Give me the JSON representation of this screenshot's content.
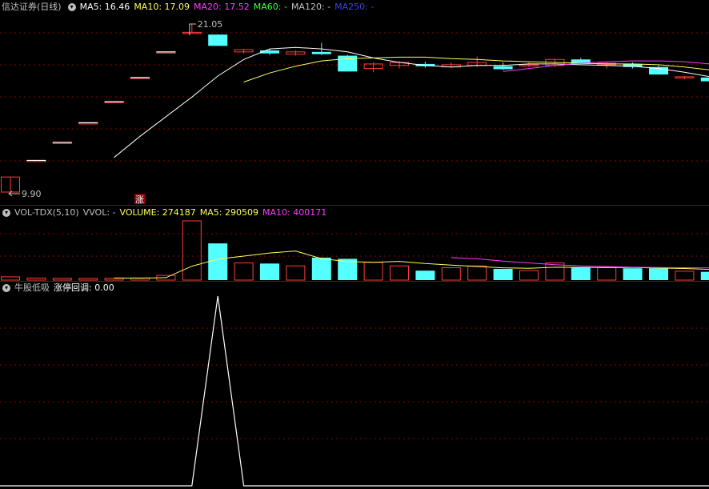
{
  "colors": {
    "up": "#ff3c3c",
    "down": "#54ffff",
    "ma5": "#ffffff",
    "ma10": "#ffff5a",
    "ma20": "#ff3cff",
    "ma60": "#3cff3c",
    "ma120": "#c0c0c0",
    "ma250": "#3c3cff",
    "grid": "#8b0000",
    "text": "#c0c0c0"
  },
  "panel_main": {
    "title": "信达证券(日线)",
    "ma_labels": [
      {
        "label": "MA5: 16.46",
        "color": "#ffffff"
      },
      {
        "label": "MA10: 17.09",
        "color": "#ffff5a"
      },
      {
        "label": "MA20: 17.52",
        "color": "#ff3cff"
      },
      {
        "label": "MA60: -",
        "color": "#3cff3c"
      },
      {
        "label": "MA120: -",
        "color": "#c0c0c0"
      },
      {
        "label": "MA250: -",
        "color": "#3c3cff"
      }
    ],
    "high_marker": "21.05",
    "low_marker": "9.90",
    "limit_badge": "涨"
  },
  "panel_vol": {
    "labels": [
      {
        "label": "VOL-TDX(5,10)",
        "color": "#c0c0c0"
      },
      {
        "label": "VVOL: -",
        "color": "#c0c0c0"
      },
      {
        "label": "VOLUME: 274187",
        "color": "#ffff5a"
      },
      {
        "label": "MA5: 290509",
        "color": "#ffff5a"
      },
      {
        "label": "MA10: 400171",
        "color": "#ff3cff"
      }
    ]
  },
  "panel_ind": {
    "labels": [
      {
        "label": "牛股低吸",
        "color": "#c0c0c0"
      },
      {
        "label": "涨停回调: 0.00",
        "color": "#ffffff"
      }
    ]
  },
  "chart_data": [
    {
      "type": "candlestick",
      "ylim": [
        9.9,
        21.05
      ],
      "bars": [
        {
          "o": 9.9,
          "h": 10.9,
          "l": 9.9,
          "c": 10.9
        },
        {
          "o": 12.0,
          "h": 12.0,
          "l": 12.0,
          "c": 12.0
        },
        {
          "o": 13.2,
          "h": 13.2,
          "l": 13.2,
          "c": 13.2
        },
        {
          "o": 14.5,
          "h": 14.5,
          "l": 14.5,
          "c": 14.5
        },
        {
          "o": 15.9,
          "h": 15.9,
          "l": 15.9,
          "c": 15.9
        },
        {
          "o": 17.5,
          "h": 17.5,
          "l": 17.5,
          "c": 17.5
        },
        {
          "o": 19.2,
          "h": 19.2,
          "l": 19.2,
          "c": 19.2
        },
        {
          "o": 20.5,
          "h": 21.05,
          "l": 20.5,
          "c": 20.5
        },
        {
          "o": 20.35,
          "h": 20.35,
          "l": 19.6,
          "c": 19.6
        },
        {
          "o": 19.2,
          "h": 19.4,
          "l": 19.1,
          "c": 19.35
        },
        {
          "o": 19.3,
          "h": 19.4,
          "l": 19.0,
          "c": 19.1
        },
        {
          "o": 19.05,
          "h": 19.3,
          "l": 18.95,
          "c": 19.2
        },
        {
          "o": 19.2,
          "h": 19.8,
          "l": 19.0,
          "c": 19.05
        },
        {
          "o": 18.95,
          "h": 19.0,
          "l": 17.9,
          "c": 17.9
        },
        {
          "o": 18.1,
          "h": 18.5,
          "l": 17.85,
          "c": 18.4
        },
        {
          "o": 18.3,
          "h": 18.6,
          "l": 18.1,
          "c": 18.5
        },
        {
          "o": 18.4,
          "h": 18.55,
          "l": 18.15,
          "c": 18.25
        },
        {
          "o": 18.2,
          "h": 18.5,
          "l": 18.15,
          "c": 18.35
        },
        {
          "o": 18.3,
          "h": 18.9,
          "l": 18.2,
          "c": 18.5
        },
        {
          "o": 18.25,
          "h": 18.5,
          "l": 18.0,
          "c": 18.05
        },
        {
          "o": 18.3,
          "h": 18.5,
          "l": 18.2,
          "c": 18.35
        },
        {
          "o": 18.3,
          "h": 18.75,
          "l": 18.2,
          "c": 18.7
        },
        {
          "o": 18.7,
          "h": 18.8,
          "l": 18.4,
          "c": 18.4
        },
        {
          "o": 18.35,
          "h": 18.5,
          "l": 18.1,
          "c": 18.45
        },
        {
          "o": 18.4,
          "h": 18.5,
          "l": 18.1,
          "c": 18.2
        },
        {
          "o": 18.2,
          "h": 18.3,
          "l": 17.7,
          "c": 17.7
        },
        {
          "o": 17.5,
          "h": 17.6,
          "l": 17.4,
          "c": 17.55
        },
        {
          "o": 17.5,
          "h": 17.55,
          "l": 17.1,
          "c": 17.25
        }
      ],
      "ma5": [
        null,
        null,
        null,
        null,
        12.2,
        13.6,
        14.9,
        16.2,
        17.6,
        18.7,
        19.4,
        19.5,
        19.4,
        19.2,
        18.8,
        18.5,
        18.3,
        18.2,
        18.3,
        18.3,
        18.4,
        18.4,
        18.35,
        18.3,
        18.25,
        18.1,
        17.85,
        17.55
      ],
      "ma10": [
        null,
        null,
        null,
        null,
        null,
        null,
        null,
        null,
        null,
        17.2,
        17.8,
        18.25,
        18.6,
        18.75,
        18.8,
        18.85,
        18.85,
        18.75,
        18.7,
        18.6,
        18.55,
        18.5,
        18.45,
        18.4,
        18.4,
        18.35,
        18.2,
        18.0
      ],
      "ma20": [
        null,
        null,
        null,
        null,
        null,
        null,
        null,
        null,
        null,
        null,
        null,
        null,
        null,
        null,
        null,
        null,
        null,
        null,
        null,
        17.9,
        18.1,
        18.3,
        18.45,
        18.55,
        18.6,
        18.6,
        18.55,
        18.4
      ]
    },
    {
      "type": "bar",
      "ylim": [
        0,
        1000000
      ],
      "values": [
        55000,
        35000,
        30000,
        30000,
        30000,
        38000,
        80000,
        1000000,
        620000,
        290000,
        280000,
        240000,
        380000,
        360000,
        300000,
        240000,
        160000,
        210000,
        240000,
        190000,
        160000,
        290000,
        220000,
        210000,
        200000,
        200000,
        150000,
        140000
      ],
      "ma5": [
        null,
        null,
        null,
        null,
        36000,
        32600,
        41600,
        235600,
        353600,
        406000,
        458000,
        492000,
        362000,
        314000,
        300000,
        316000,
        280000,
        254000,
        230000,
        208000,
        200000,
        218000,
        212000,
        214000,
        214000,
        204000,
        196000,
        180000
      ],
      "ma10": [
        null,
        null,
        null,
        null,
        null,
        null,
        null,
        null,
        null,
        null,
        null,
        null,
        null,
        null,
        null,
        null,
        null,
        380000,
        360000,
        320000,
        290000,
        260000,
        240000,
        230000,
        218000,
        212000,
        210000,
        205000
      ]
    },
    {
      "type": "line",
      "ylim": [
        0,
        1
      ],
      "values": [
        0,
        0,
        0,
        0,
        0,
        0,
        0,
        0,
        1,
        0,
        0,
        0,
        0,
        0,
        0,
        0,
        0,
        0,
        0,
        0,
        0,
        0,
        0,
        0,
        0,
        0,
        0,
        0
      ]
    }
  ]
}
